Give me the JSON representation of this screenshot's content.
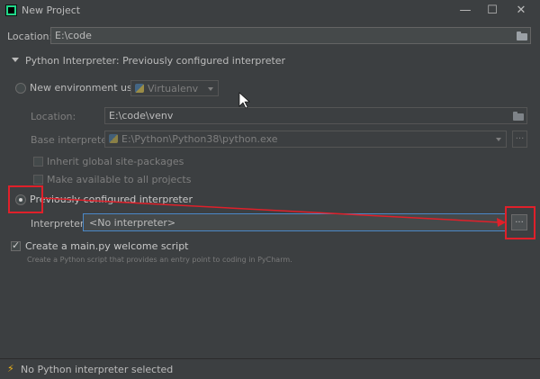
{
  "window": {
    "title": "New Project"
  },
  "location": {
    "label": "Location:",
    "value": "E:\\code"
  },
  "section": {
    "title": "Python Interpreter: Previously configured interpreter"
  },
  "new_env": {
    "label": "New environment using",
    "tool": "Virtualenv",
    "location_label": "Location:",
    "location_value": "E:\\code\\venv",
    "base_label": "Base interpreter:",
    "base_value": "E:\\Python\\Python38\\python.exe",
    "inherit_label": "Inherit global site-packages",
    "available_label": "Make available to all projects"
  },
  "prev": {
    "label": "Previously configured interpreter",
    "interpreter_label": "Interpreter:",
    "interpreter_value": "<No interpreter>",
    "browse_label": "..."
  },
  "welcome": {
    "label": "Create a main.py welcome script",
    "description": "Create a Python script that provides an entry point to coding in PyCharm."
  },
  "status": {
    "text": "No Python interpreter selected"
  },
  "icons": {
    "logo": "pycharm-logo",
    "folder": "folder-icon",
    "python": "python-icon",
    "warning": "lightning-icon"
  },
  "colors": {
    "annotation": "#e0202a",
    "focus": "#4a88c7",
    "warning": "#f2b616"
  }
}
